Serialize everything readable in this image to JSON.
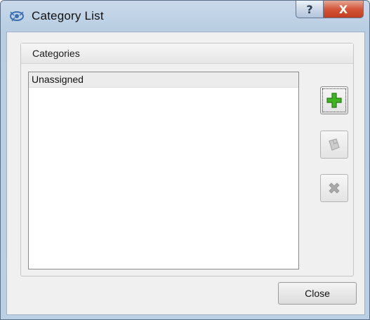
{
  "window": {
    "title": "Category List",
    "help_label": "?",
    "close_label": "X"
  },
  "group": {
    "label": "Categories",
    "items": [
      {
        "label": "Unassigned"
      }
    ]
  },
  "side_buttons": [
    {
      "name": "add-category-button",
      "icon": "plus-icon",
      "enabled": true
    },
    {
      "name": "edit-category-button",
      "icon": "edit-icon",
      "enabled": false
    },
    {
      "name": "delete-category-button",
      "icon": "x-icon",
      "enabled": false
    }
  ],
  "footer": {
    "close_label": "Close"
  },
  "colors": {
    "add_icon": "#3fb521",
    "disabled_icon": "#a9a9a9",
    "title_close": "#c8472b"
  }
}
